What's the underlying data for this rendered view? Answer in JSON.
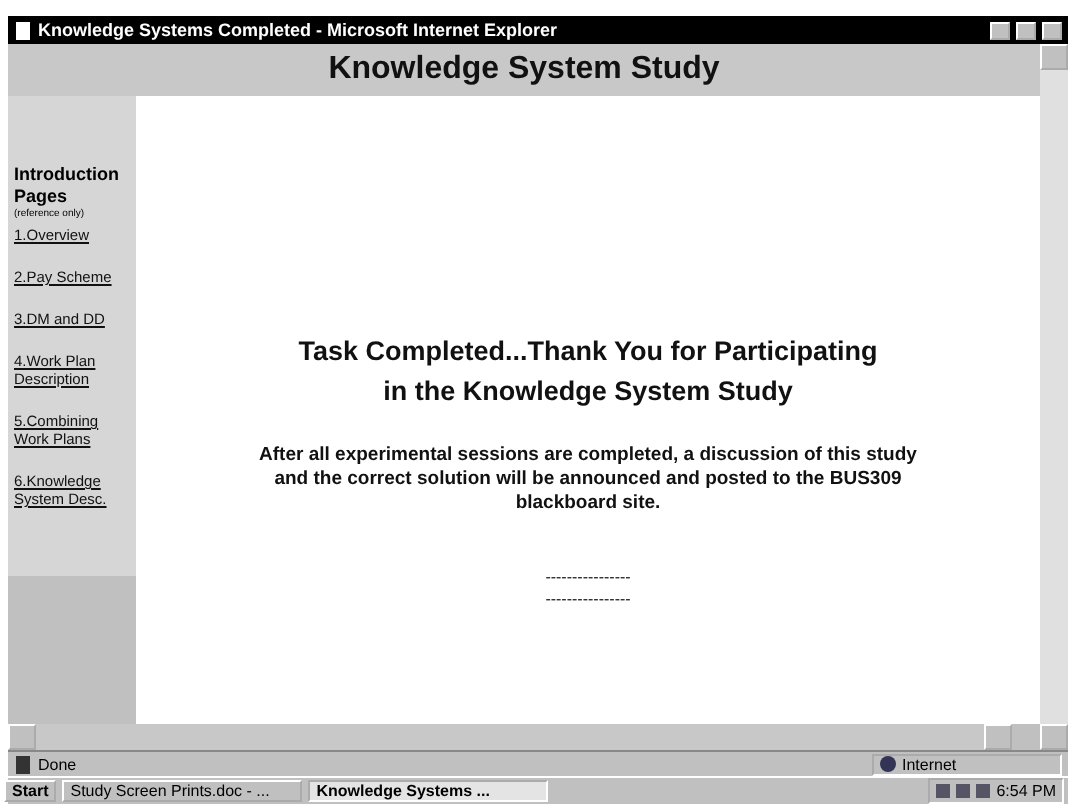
{
  "window": {
    "title": "Knowledge Systems Completed - Microsoft Internet Explorer"
  },
  "page_header": "Knowledge System Study",
  "sidebar": {
    "heading": "Introduction Pages",
    "note": "(reference only)",
    "links": [
      "1.Overview",
      "2.Pay Scheme",
      "3.DM and DD",
      "4.Work Plan Description",
      "5.Combining Work Plans",
      "6.Knowledge System Desc."
    ]
  },
  "main": {
    "heading_lines": [
      "Task Completed...Thank You for Participating",
      "in the Knowledge System Study"
    ],
    "paragraph": "After all experimental sessions are completed, a discussion of this study and the correct solution will be announced and posted to the BUS309 blackboard site.",
    "dash_lines": [
      "----------------",
      "----------------"
    ]
  },
  "status_bar": {
    "text": "Done",
    "zone": "Internet"
  },
  "taskbar": {
    "start": "Start",
    "tasks": [
      {
        "label": "Study Screen Prints.doc - ...",
        "selected": false
      },
      {
        "label": "Knowledge Systems ...",
        "selected": true
      }
    ],
    "clock": "6:54 PM"
  }
}
